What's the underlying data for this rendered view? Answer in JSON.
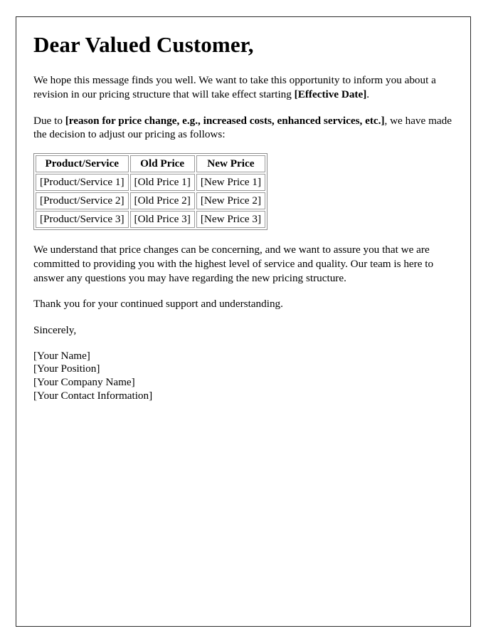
{
  "document": {
    "heading": "Dear Valued Customer,",
    "paragraph_1": {
      "text_before": "We hope this message finds you well. We want to take this opportunity to inform you about a revision in our pricing structure that will take effect starting ",
      "placeholder": "[Effective Date]",
      "text_after": "."
    },
    "paragraph_2": {
      "text_before": "Due to ",
      "placeholder": "[reason for price change, e.g., increased costs, enhanced services, etc.]",
      "text_after": ", we have made the decision to adjust our pricing as follows:"
    },
    "paragraph_3": "We understand that price changes can be concerning, and we want to assure you that we are committed to providing you with the highest level of service and quality. Our team is here to answer any questions you may have regarding the new pricing structure.",
    "paragraph_4": "Thank you for your continued support and understanding.",
    "closing": "Sincerely,",
    "signature": [
      "[Your Name]",
      "[Your Position]",
      "[Your Company Name]",
      "[Your Contact Information]"
    ]
  },
  "price_table": {
    "headers": [
      "Product/Service",
      "Old Price",
      "New Price"
    ],
    "rows": [
      [
        "[Product/Service 1]",
        "[Old Price 1]",
        "[New Price 1]"
      ],
      [
        "[Product/Service 2]",
        "[Old Price 2]",
        "[New Price 2]"
      ],
      [
        "[Product/Service 3]",
        "[Old Price 3]",
        "[New Price 3]"
      ]
    ]
  },
  "colors": {
    "page_border": "#2b2b2b",
    "table_border": "#9a9a9a",
    "text": "#000000",
    "background": "#ffffff"
  }
}
